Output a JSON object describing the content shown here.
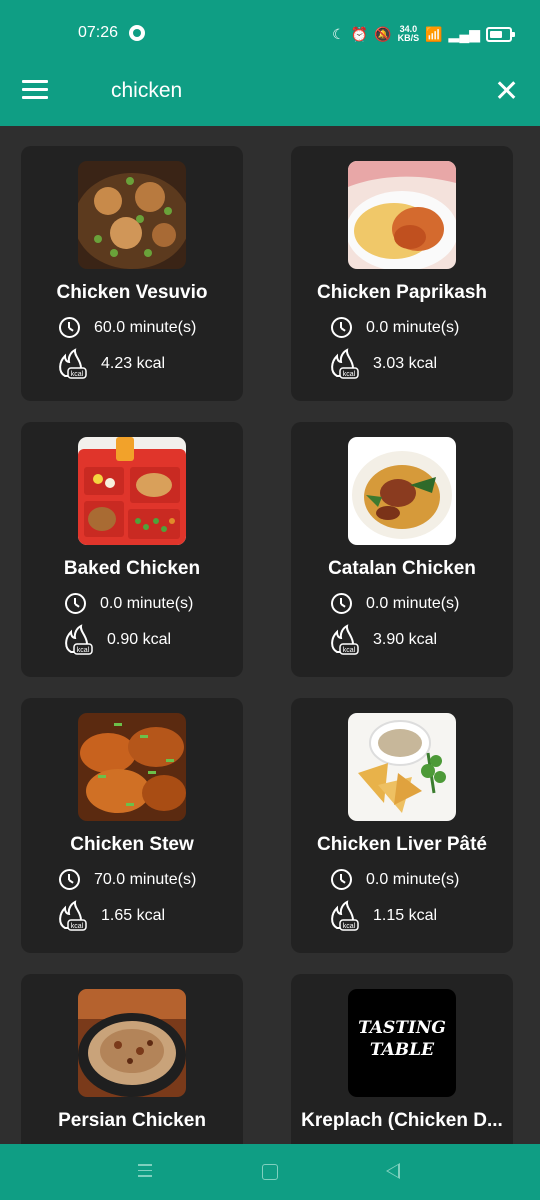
{
  "status": {
    "time": "07:26",
    "net_speed": "34.0",
    "net_unit": "KB/S"
  },
  "appbar": {
    "query": "chicken"
  },
  "recipes": [
    {
      "title": "Chicken Vesuvio",
      "time": "60.0 minute(s)",
      "kcal": "4.23 kcal",
      "kcal_badge": "kcal"
    },
    {
      "title": "Chicken Paprikash",
      "time": "0.0 minute(s)",
      "kcal": "3.03 kcal",
      "kcal_badge": "kcal"
    },
    {
      "title": "Baked Chicken",
      "time": "0.0 minute(s)",
      "kcal": "0.90 kcal",
      "kcal_badge": "kcal"
    },
    {
      "title": "Catalan Chicken",
      "time": "0.0 minute(s)",
      "kcal": "3.90 kcal",
      "kcal_badge": "kcal"
    },
    {
      "title": "Chicken Stew",
      "time": "70.0 minute(s)",
      "kcal": "1.65 kcal",
      "kcal_badge": "kcal"
    },
    {
      "title": "Chicken Liver Pâté",
      "time": "0.0 minute(s)",
      "kcal": "1.15 kcal",
      "kcal_badge": "kcal"
    },
    {
      "title": "Persian Chicken"
    },
    {
      "title": "Kreplach (Chicken D...",
      "logo_line1": "TASTING",
      "logo_line2": "TABLE"
    }
  ],
  "colors": {
    "primary": "#0f9e84",
    "card": "#222222",
    "background": "#2f2f2f"
  }
}
